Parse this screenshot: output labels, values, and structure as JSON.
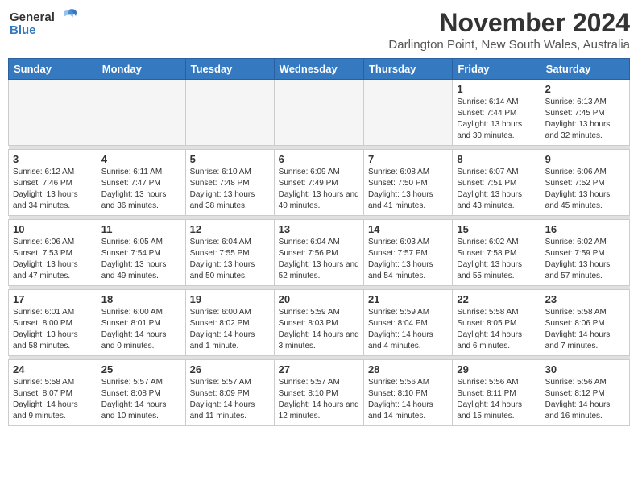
{
  "header": {
    "logo_general": "General",
    "logo_blue": "Blue",
    "month_title": "November 2024",
    "location": "Darlington Point, New South Wales, Australia"
  },
  "days_of_week": [
    "Sunday",
    "Monday",
    "Tuesday",
    "Wednesday",
    "Thursday",
    "Friday",
    "Saturday"
  ],
  "weeks": [
    [
      {
        "day": "",
        "sunrise": "",
        "sunset": "",
        "daylight": "",
        "empty": true
      },
      {
        "day": "",
        "sunrise": "",
        "sunset": "",
        "daylight": "",
        "empty": true
      },
      {
        "day": "",
        "sunrise": "",
        "sunset": "",
        "daylight": "",
        "empty": true
      },
      {
        "day": "",
        "sunrise": "",
        "sunset": "",
        "daylight": "",
        "empty": true
      },
      {
        "day": "",
        "sunrise": "",
        "sunset": "",
        "daylight": "",
        "empty": true
      },
      {
        "day": "1",
        "sunrise": "Sunrise: 6:14 AM",
        "sunset": "Sunset: 7:44 PM",
        "daylight": "Daylight: 13 hours and 30 minutes.",
        "empty": false
      },
      {
        "day": "2",
        "sunrise": "Sunrise: 6:13 AM",
        "sunset": "Sunset: 7:45 PM",
        "daylight": "Daylight: 13 hours and 32 minutes.",
        "empty": false
      }
    ],
    [
      {
        "day": "3",
        "sunrise": "Sunrise: 6:12 AM",
        "sunset": "Sunset: 7:46 PM",
        "daylight": "Daylight: 13 hours and 34 minutes.",
        "empty": false
      },
      {
        "day": "4",
        "sunrise": "Sunrise: 6:11 AM",
        "sunset": "Sunset: 7:47 PM",
        "daylight": "Daylight: 13 hours and 36 minutes.",
        "empty": false
      },
      {
        "day": "5",
        "sunrise": "Sunrise: 6:10 AM",
        "sunset": "Sunset: 7:48 PM",
        "daylight": "Daylight: 13 hours and 38 minutes.",
        "empty": false
      },
      {
        "day": "6",
        "sunrise": "Sunrise: 6:09 AM",
        "sunset": "Sunset: 7:49 PM",
        "daylight": "Daylight: 13 hours and 40 minutes.",
        "empty": false
      },
      {
        "day": "7",
        "sunrise": "Sunrise: 6:08 AM",
        "sunset": "Sunset: 7:50 PM",
        "daylight": "Daylight: 13 hours and 41 minutes.",
        "empty": false
      },
      {
        "day": "8",
        "sunrise": "Sunrise: 6:07 AM",
        "sunset": "Sunset: 7:51 PM",
        "daylight": "Daylight: 13 hours and 43 minutes.",
        "empty": false
      },
      {
        "day": "9",
        "sunrise": "Sunrise: 6:06 AM",
        "sunset": "Sunset: 7:52 PM",
        "daylight": "Daylight: 13 hours and 45 minutes.",
        "empty": false
      }
    ],
    [
      {
        "day": "10",
        "sunrise": "Sunrise: 6:06 AM",
        "sunset": "Sunset: 7:53 PM",
        "daylight": "Daylight: 13 hours and 47 minutes.",
        "empty": false
      },
      {
        "day": "11",
        "sunrise": "Sunrise: 6:05 AM",
        "sunset": "Sunset: 7:54 PM",
        "daylight": "Daylight: 13 hours and 49 minutes.",
        "empty": false
      },
      {
        "day": "12",
        "sunrise": "Sunrise: 6:04 AM",
        "sunset": "Sunset: 7:55 PM",
        "daylight": "Daylight: 13 hours and 50 minutes.",
        "empty": false
      },
      {
        "day": "13",
        "sunrise": "Sunrise: 6:04 AM",
        "sunset": "Sunset: 7:56 PM",
        "daylight": "Daylight: 13 hours and 52 minutes.",
        "empty": false
      },
      {
        "day": "14",
        "sunrise": "Sunrise: 6:03 AM",
        "sunset": "Sunset: 7:57 PM",
        "daylight": "Daylight: 13 hours and 54 minutes.",
        "empty": false
      },
      {
        "day": "15",
        "sunrise": "Sunrise: 6:02 AM",
        "sunset": "Sunset: 7:58 PM",
        "daylight": "Daylight: 13 hours and 55 minutes.",
        "empty": false
      },
      {
        "day": "16",
        "sunrise": "Sunrise: 6:02 AM",
        "sunset": "Sunset: 7:59 PM",
        "daylight": "Daylight: 13 hours and 57 minutes.",
        "empty": false
      }
    ],
    [
      {
        "day": "17",
        "sunrise": "Sunrise: 6:01 AM",
        "sunset": "Sunset: 8:00 PM",
        "daylight": "Daylight: 13 hours and 58 minutes.",
        "empty": false
      },
      {
        "day": "18",
        "sunrise": "Sunrise: 6:00 AM",
        "sunset": "Sunset: 8:01 PM",
        "daylight": "Daylight: 14 hours and 0 minutes.",
        "empty": false
      },
      {
        "day": "19",
        "sunrise": "Sunrise: 6:00 AM",
        "sunset": "Sunset: 8:02 PM",
        "daylight": "Daylight: 14 hours and 1 minute.",
        "empty": false
      },
      {
        "day": "20",
        "sunrise": "Sunrise: 5:59 AM",
        "sunset": "Sunset: 8:03 PM",
        "daylight": "Daylight: 14 hours and 3 minutes.",
        "empty": false
      },
      {
        "day": "21",
        "sunrise": "Sunrise: 5:59 AM",
        "sunset": "Sunset: 8:04 PM",
        "daylight": "Daylight: 14 hours and 4 minutes.",
        "empty": false
      },
      {
        "day": "22",
        "sunrise": "Sunrise: 5:58 AM",
        "sunset": "Sunset: 8:05 PM",
        "daylight": "Daylight: 14 hours and 6 minutes.",
        "empty": false
      },
      {
        "day": "23",
        "sunrise": "Sunrise: 5:58 AM",
        "sunset": "Sunset: 8:06 PM",
        "daylight": "Daylight: 14 hours and 7 minutes.",
        "empty": false
      }
    ],
    [
      {
        "day": "24",
        "sunrise": "Sunrise: 5:58 AM",
        "sunset": "Sunset: 8:07 PM",
        "daylight": "Daylight: 14 hours and 9 minutes.",
        "empty": false
      },
      {
        "day": "25",
        "sunrise": "Sunrise: 5:57 AM",
        "sunset": "Sunset: 8:08 PM",
        "daylight": "Daylight: 14 hours and 10 minutes.",
        "empty": false
      },
      {
        "day": "26",
        "sunrise": "Sunrise: 5:57 AM",
        "sunset": "Sunset: 8:09 PM",
        "daylight": "Daylight: 14 hours and 11 minutes.",
        "empty": false
      },
      {
        "day": "27",
        "sunrise": "Sunrise: 5:57 AM",
        "sunset": "Sunset: 8:10 PM",
        "daylight": "Daylight: 14 hours and 12 minutes.",
        "empty": false
      },
      {
        "day": "28",
        "sunrise": "Sunrise: 5:56 AM",
        "sunset": "Sunset: 8:10 PM",
        "daylight": "Daylight: 14 hours and 14 minutes.",
        "empty": false
      },
      {
        "day": "29",
        "sunrise": "Sunrise: 5:56 AM",
        "sunset": "Sunset: 8:11 PM",
        "daylight": "Daylight: 14 hours and 15 minutes.",
        "empty": false
      },
      {
        "day": "30",
        "sunrise": "Sunrise: 5:56 AM",
        "sunset": "Sunset: 8:12 PM",
        "daylight": "Daylight: 14 hours and 16 minutes.",
        "empty": false
      }
    ]
  ]
}
